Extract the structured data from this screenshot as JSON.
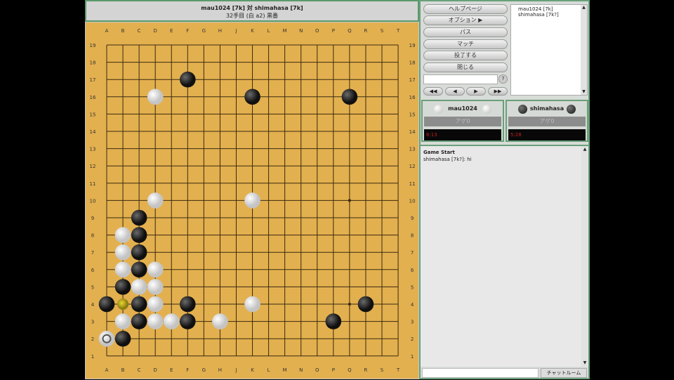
{
  "header": {
    "title": "mau1024 [7k] 対 shimahasa [7k]",
    "status": "32手目 (白 a2) 黒番"
  },
  "board": {
    "columns": [
      "A",
      "B",
      "C",
      "D",
      "E",
      "F",
      "G",
      "H",
      "J",
      "K",
      "L",
      "M",
      "N",
      "O",
      "P",
      "Q",
      "R",
      "S",
      "T"
    ],
    "rows": [
      "19",
      "18",
      "17",
      "16",
      "15",
      "14",
      "13",
      "12",
      "11",
      "10",
      "9",
      "8",
      "7",
      "6",
      "5",
      "4",
      "3",
      "2",
      "1"
    ],
    "colors": {
      "board": "#e3b04f",
      "line": "#3a2a10",
      "black": "#222222",
      "white": "#f2f2f2",
      "marker": "#c8b020"
    },
    "stones": [
      {
        "pos": "F17",
        "color": "black"
      },
      {
        "pos": "K16",
        "color": "black"
      },
      {
        "pos": "Q16",
        "color": "black"
      },
      {
        "pos": "D16",
        "color": "white"
      },
      {
        "pos": "D10",
        "color": "white"
      },
      {
        "pos": "K10",
        "color": "white"
      },
      {
        "pos": "C9",
        "color": "black"
      },
      {
        "pos": "B8",
        "color": "white"
      },
      {
        "pos": "C8",
        "color": "black"
      },
      {
        "pos": "B7",
        "color": "white"
      },
      {
        "pos": "C7",
        "color": "black"
      },
      {
        "pos": "B6",
        "color": "white"
      },
      {
        "pos": "C6",
        "color": "black"
      },
      {
        "pos": "D6",
        "color": "white"
      },
      {
        "pos": "B5",
        "color": "black"
      },
      {
        "pos": "C5",
        "color": "white"
      },
      {
        "pos": "D5",
        "color": "white"
      },
      {
        "pos": "A4",
        "color": "black"
      },
      {
        "pos": "C4",
        "color": "black"
      },
      {
        "pos": "D4",
        "color": "white"
      },
      {
        "pos": "F4",
        "color": "black"
      },
      {
        "pos": "K4",
        "color": "white"
      },
      {
        "pos": "R4",
        "color": "black"
      },
      {
        "pos": "B3",
        "color": "white"
      },
      {
        "pos": "C3",
        "color": "black"
      },
      {
        "pos": "D3",
        "color": "white"
      },
      {
        "pos": "E3",
        "color": "white"
      },
      {
        "pos": "F3",
        "color": "black"
      },
      {
        "pos": "H3",
        "color": "white"
      },
      {
        "pos": "P3",
        "color": "black"
      },
      {
        "pos": "A2",
        "color": "white",
        "last_move": true
      },
      {
        "pos": "B2",
        "color": "black"
      }
    ],
    "markers": [
      {
        "pos": "B4",
        "color": "yellow"
      }
    ]
  },
  "menu": {
    "buttons": [
      "ヘルプページ",
      "オプション ▶",
      "パス",
      "マッチ",
      "投了する",
      "閉じる"
    ],
    "nav": [
      "◀◀",
      "◀",
      "▶",
      "▶▶"
    ],
    "help_icon": "?"
  },
  "users": [
    "mau1024 [7k]",
    "shimahasa [7k?]"
  ],
  "players": [
    {
      "name": "mau1024",
      "stone": "white",
      "captures": "アゲ0",
      "clock": "6:13"
    },
    {
      "name": "shimahasa",
      "stone": "black",
      "captures": "アゲ0",
      "clock": "5:28"
    }
  ],
  "chat": {
    "lines": [
      "Game Start",
      "shimahasa [7k?]: hi"
    ],
    "button": "チャットルーム",
    "input": ""
  }
}
